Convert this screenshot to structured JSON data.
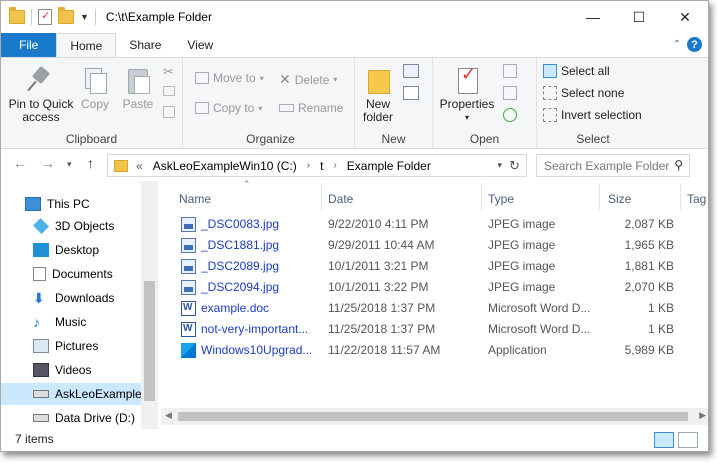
{
  "window": {
    "title": "C:\\t\\Example Folder"
  },
  "window_controls": {
    "minimize": "—",
    "maximize": "☐",
    "close": "✕"
  },
  "tabs": [
    "File",
    "Home",
    "Share",
    "View"
  ],
  "help": "?",
  "ribbon": {
    "clipboard": {
      "label": "Clipboard",
      "pin": "Pin to Quick access",
      "copy": "Copy",
      "paste": "Paste"
    },
    "organize": {
      "label": "Organize",
      "move_to": "Move to",
      "copy_to": "Copy to",
      "delete": "Delete",
      "rename": "Rename"
    },
    "new": {
      "label": "New",
      "new_folder": "New folder"
    },
    "open": {
      "label": "Open",
      "properties": "Properties"
    },
    "select": {
      "label": "Select",
      "select_all": "Select all",
      "select_none": "Select none",
      "invert": "Invert selection"
    }
  },
  "address": {
    "segments": [
      "AskLeoExampleWin10 (C:)",
      "t",
      "Example Folder"
    ],
    "overflow": "«",
    "search_placeholder": "Search Example Folder"
  },
  "nav": [
    {
      "label": "This PC",
      "icon": "computer-icon"
    },
    {
      "label": "3D Objects",
      "icon": "cube-icon"
    },
    {
      "label": "Desktop",
      "icon": "desktop-icon"
    },
    {
      "label": "Documents",
      "icon": "documents-icon"
    },
    {
      "label": "Downloads",
      "icon": "download-arrow-icon"
    },
    {
      "label": "Music",
      "icon": "music-note-icon"
    },
    {
      "label": "Pictures",
      "icon": "pictures-icon"
    },
    {
      "label": "Videos",
      "icon": "film-icon"
    },
    {
      "label": "AskLeoExampleW",
      "icon": "drive-icon",
      "selected": true
    },
    {
      "label": "Data Drive (D:)",
      "icon": "drive-icon"
    }
  ],
  "columns": {
    "name": "Name",
    "date": "Date",
    "type": "Type",
    "size": "Size",
    "tags": "Tag"
  },
  "files": [
    {
      "name": "_DSC0083.jpg",
      "date": "9/22/2010 4:11 PM",
      "type": "JPEG image",
      "size": "2,087 KB",
      "icon": "jpg"
    },
    {
      "name": "_DSC1881.jpg",
      "date": "9/29/2011 10:44 AM",
      "type": "JPEG image",
      "size": "1,965 KB",
      "icon": "jpg"
    },
    {
      "name": "_DSC2089.jpg",
      "date": "10/1/2011 3:21 PM",
      "type": "JPEG image",
      "size": "1,881 KB",
      "icon": "jpg"
    },
    {
      "name": "_DSC2094.jpg",
      "date": "10/1/2011 3:22 PM",
      "type": "JPEG image",
      "size": "2,070 KB",
      "icon": "jpg"
    },
    {
      "name": "example.doc",
      "date": "11/25/2018 1:37 PM",
      "type": "Microsoft Word D...",
      "size": "1 KB",
      "icon": "doc"
    },
    {
      "name": "not-very-important...",
      "date": "11/25/2018 1:37 PM",
      "type": "Microsoft Word D...",
      "size": "1 KB",
      "icon": "doc"
    },
    {
      "name": "Windows10Upgrad...",
      "date": "11/22/2018 11:57 AM",
      "type": "Application",
      "size": "5,989 KB",
      "icon": "exe"
    }
  ],
  "status": {
    "count": "7 items"
  }
}
